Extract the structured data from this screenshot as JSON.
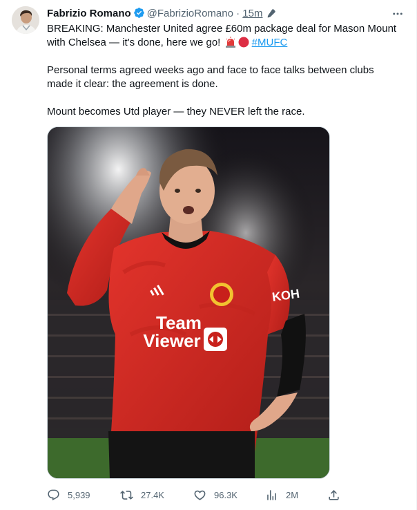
{
  "author": {
    "name": "Fabrizio Romano",
    "handle": "@FabrizioRomano",
    "separator": "·",
    "time": "15m"
  },
  "tweet": {
    "line1_prefix": "BREAKING: Manchester United agree £60m package deal for Mason Mount",
    "line2_prefix": "with Chelsea — it's done, here we go! ",
    "hashtag": "#MUFC",
    "paragraph2": "Personal terms agreed weeks ago and face to face talks between clubs made it clear: the agreement is done.",
    "paragraph3": "Mount becomes Utd player — they NEVER left the race."
  },
  "media": {
    "sponsor_line1": "Team",
    "sponsor_line2": "Viewer",
    "sleeve_brand": "KOH"
  },
  "actions": {
    "replies": "5,939",
    "reposts": "27.4K",
    "likes": "96.3K",
    "views": "2M"
  },
  "colors": {
    "link": "#1d9bf0",
    "verified": "#1d9bf0",
    "muted": "#536471",
    "shirt_red": "#d42a23"
  },
  "icons": [
    "verified-badge-icon",
    "edit-pencil-icon",
    "more-options-icon",
    "rotating-light-emoji-icon",
    "red-circle-emoji-icon",
    "reply-icon",
    "repost-icon",
    "like-icon",
    "views-icon",
    "share-icon"
  ]
}
